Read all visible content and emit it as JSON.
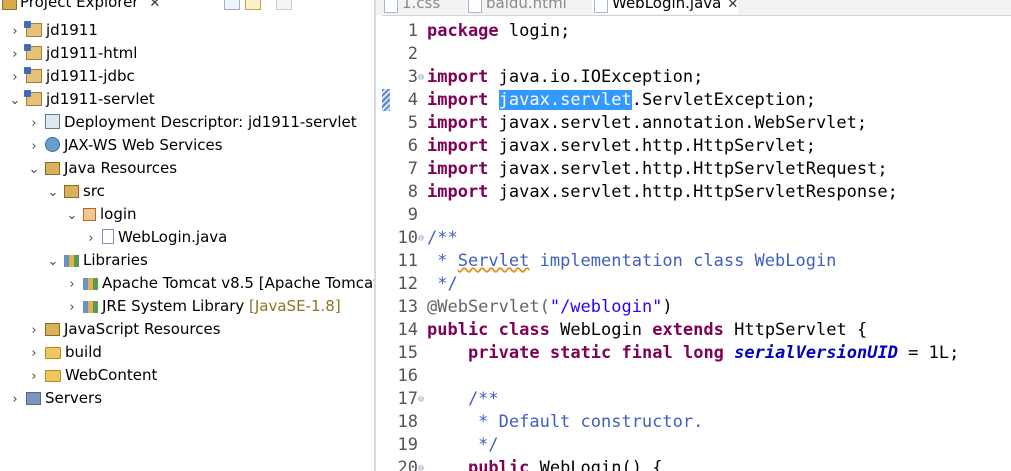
{
  "explorer": {
    "title": "Project Explorer",
    "close_glyph": "✕",
    "items": [
      {
        "label": "jd1911",
        "twisty": "›",
        "icon": "project-icon"
      },
      {
        "label": "jd1911-html",
        "twisty": "›",
        "icon": "project-icon"
      },
      {
        "label": "jd1911-jdbc",
        "twisty": "›",
        "icon": "project-icon"
      },
      {
        "label": "jd1911-servlet",
        "twisty": "⌄",
        "icon": "project-icon"
      },
      {
        "label": "Deployment Descriptor: jd1911-servlet",
        "twisty": "›",
        "icon": "deployment-descriptor-icon"
      },
      {
        "label": "JAX-WS Web Services",
        "twisty": "›",
        "icon": "web-services-icon"
      },
      {
        "label": "Java Resources",
        "twisty": "⌄",
        "icon": "java-resources-icon"
      },
      {
        "label": "src",
        "twisty": "⌄",
        "icon": "source-folder-icon"
      },
      {
        "label": "login",
        "twisty": "⌄",
        "icon": "package-icon"
      },
      {
        "label": "WebLogin.java",
        "twisty": "›",
        "icon": "java-file-icon"
      },
      {
        "label": "Libraries",
        "twisty": "⌄",
        "icon": "library-icon"
      },
      {
        "label": "Apache Tomcat v8.5 [Apache Tomcat",
        "twisty": "›",
        "icon": "library-icon"
      },
      {
        "label": "JRE System Library ",
        "decoration": "[JavaSE-1.8]",
        "twisty": "›",
        "icon": "library-icon"
      },
      {
        "label": "JavaScript Resources",
        "twisty": "›",
        "icon": "javascript-resources-icon"
      },
      {
        "label": "build",
        "twisty": "›",
        "icon": "folder-icon"
      },
      {
        "label": "WebContent",
        "twisty": "›",
        "icon": "folder-icon"
      },
      {
        "label": "Servers",
        "twisty": "›",
        "icon": "server-icon"
      }
    ]
  },
  "editor": {
    "tabs": [
      {
        "label": "1.css",
        "active": false
      },
      {
        "label": "baidu.html",
        "active": false
      },
      {
        "label": "WebLogin.java",
        "active": true
      }
    ],
    "close_glyph": "✕",
    "fold_glyph": "⊖",
    "lines": [
      {
        "n": "1",
        "segs": [
          {
            "t": "package",
            "c": "kw"
          },
          {
            "t": " login;",
            "c": ""
          }
        ]
      },
      {
        "n": "2",
        "segs": []
      },
      {
        "n": "3",
        "fold": true,
        "segs": [
          {
            "t": "import",
            "c": "kw"
          },
          {
            "t": " java.io.IOException;",
            "c": ""
          }
        ]
      },
      {
        "n": "4",
        "segs": [
          {
            "t": "import",
            "c": "kw"
          },
          {
            "t": " ",
            "c": ""
          },
          {
            "t": "javax.servlet",
            "c": "sel"
          },
          {
            "t": ".ServletException;",
            "c": ""
          }
        ]
      },
      {
        "n": "5",
        "segs": [
          {
            "t": "import",
            "c": "kw"
          },
          {
            "t": " javax.servlet.annotation.WebServlet;",
            "c": ""
          }
        ]
      },
      {
        "n": "6",
        "segs": [
          {
            "t": "import",
            "c": "kw"
          },
          {
            "t": " javax.servlet.http.HttpServlet;",
            "c": ""
          }
        ]
      },
      {
        "n": "7",
        "segs": [
          {
            "t": "import",
            "c": "kw"
          },
          {
            "t": " javax.servlet.http.HttpServletRequest;",
            "c": ""
          }
        ]
      },
      {
        "n": "8",
        "segs": [
          {
            "t": "import",
            "c": "kw"
          },
          {
            "t": " javax.servlet.http.HttpServletResponse;",
            "c": ""
          }
        ]
      },
      {
        "n": "9",
        "segs": []
      },
      {
        "n": "10",
        "fold": true,
        "segs": [
          {
            "t": "/**",
            "c": "cmt"
          }
        ]
      },
      {
        "n": "11",
        "segs": [
          {
            "t": " * ",
            "c": "cmt"
          },
          {
            "t": "Servlet",
            "c": "cmt squig"
          },
          {
            "t": " implementation class WebLogin",
            "c": "cmt"
          }
        ]
      },
      {
        "n": "12",
        "segs": [
          {
            "t": " */",
            "c": "cmt"
          }
        ]
      },
      {
        "n": "13",
        "segs": [
          {
            "t": "@WebServlet(",
            "c": "ann"
          },
          {
            "t": "\"/weblogin\"",
            "c": "str"
          },
          {
            "t": ")",
            "c": ""
          }
        ]
      },
      {
        "n": "14",
        "segs": [
          {
            "t": "public",
            "c": "kw"
          },
          {
            "t": " ",
            "c": ""
          },
          {
            "t": "class",
            "c": "kw"
          },
          {
            "t": " WebLogin ",
            "c": ""
          },
          {
            "t": "extends",
            "c": "kw"
          },
          {
            "t": " HttpServlet {",
            "c": ""
          }
        ]
      },
      {
        "n": "15",
        "segs": [
          {
            "t": "    ",
            "c": ""
          },
          {
            "t": "private",
            "c": "kw"
          },
          {
            "t": " ",
            "c": ""
          },
          {
            "t": "static",
            "c": "kw"
          },
          {
            "t": " ",
            "c": ""
          },
          {
            "t": "final",
            "c": "kw"
          },
          {
            "t": " ",
            "c": ""
          },
          {
            "t": "long",
            "c": "kw"
          },
          {
            "t": " ",
            "c": ""
          },
          {
            "t": "serialVersionUID",
            "c": "fld"
          },
          {
            "t": " = 1L;",
            "c": ""
          }
        ]
      },
      {
        "n": "16",
        "segs": []
      },
      {
        "n": "17",
        "fold": true,
        "segs": [
          {
            "t": "    /**",
            "c": "cmt"
          }
        ]
      },
      {
        "n": "18",
        "segs": [
          {
            "t": "     * Default constructor.",
            "c": "cmt"
          }
        ]
      },
      {
        "n": "19",
        "segs": [
          {
            "t": "     */",
            "c": "cmt"
          }
        ]
      },
      {
        "n": "20",
        "fold": true,
        "segs": [
          {
            "t": "    ",
            "c": ""
          },
          {
            "t": "public",
            "c": "kw"
          },
          {
            "t": " WebLogin() {",
            "c": ""
          }
        ]
      }
    ]
  }
}
